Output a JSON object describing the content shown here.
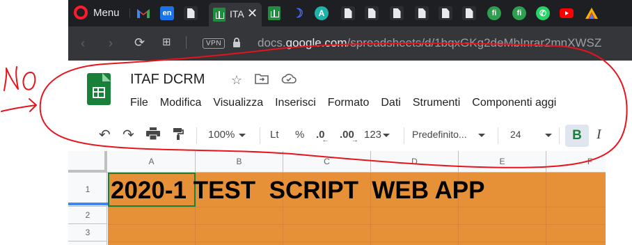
{
  "browser": {
    "menu_label": "Menu",
    "active_tab_title": "ITA",
    "url": {
      "prefix": "docs.",
      "host": "google.com",
      "path": "/spreadsheets/d/1bqxGKg2deMbInrar2mnXWSZ"
    },
    "vpn_label": "VPN",
    "tab_icons": [
      "gmail-icon",
      "en-icon",
      "doc-icon",
      "sheets-icon",
      "sheets-icon",
      "moon-icon",
      "a-icon",
      "doc-icon",
      "doc-icon",
      "doc-icon",
      "doc-icon",
      "doc-icon",
      "fi-icon",
      "fi-icon",
      "whatsapp-icon",
      "youtube-icon",
      "vivaldi-icon"
    ]
  },
  "document": {
    "title": "ITAF DCRM",
    "menu": [
      "File",
      "Modifica",
      "Visualizza",
      "Inserisci",
      "Formato",
      "Dati",
      "Strumenti",
      "Componenti aggi"
    ]
  },
  "toolbar": {
    "zoom": "100%",
    "currency": "Lt",
    "percent": "%",
    "dec_decrease": ".0",
    "dec_increase": ".00",
    "more_formats": "123",
    "font": "Predefinito...",
    "font_size": "24",
    "bold": "B",
    "italic": "I"
  },
  "sheet": {
    "columns": [
      "A",
      "B",
      "C",
      "D",
      "E",
      "F"
    ],
    "rows": [
      "1",
      "2",
      "3"
    ],
    "a1_text": "2020-1 TEST  SCRIPT  WEB APP",
    "fill_color": "#e69138",
    "selection_color": "#188038"
  },
  "annotation": {
    "text": "NO",
    "color": "#e8131c"
  },
  "colors": {
    "tab_bar": "#1d1f23",
    "address_bar": "#35363a",
    "sheets_green": "#188038"
  }
}
